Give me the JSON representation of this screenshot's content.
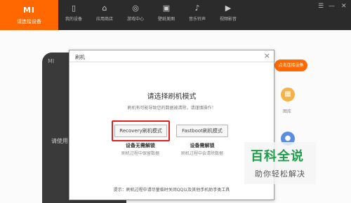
{
  "topbar": {
    "brand": {
      "logo": "MI",
      "label": "请连接设备"
    },
    "nav": [
      {
        "icon": "phone-icon",
        "glyph": "▯",
        "label": "我的设备"
      },
      {
        "icon": "store-icon",
        "glyph": "⌂",
        "label": "应用商店"
      },
      {
        "icon": "gamepad-icon",
        "glyph": "◎",
        "label": "游戏中心"
      },
      {
        "icon": "image-icon",
        "glyph": "▣",
        "label": "壁纸美图"
      },
      {
        "icon": "music-icon",
        "glyph": "♪",
        "label": "音乐铃声"
      },
      {
        "icon": "video-icon",
        "glyph": "▶",
        "label": "视频影音"
      }
    ],
    "window_controls": {
      "menu": "☰",
      "minimize": "—",
      "close": "✕"
    }
  },
  "background": {
    "phone_status": "MI",
    "phone_text": "请使用",
    "orange_pill": "点击连接设备",
    "gallery_label": "图库"
  },
  "dialog": {
    "title": "刷机",
    "close": "×",
    "heading": "请选择刷机模式",
    "subheading": "刷机有可能导致您的数据被清除，请谨慎操作！",
    "recovery": {
      "button": "Recovery刷机模式",
      "title": "设备无需解锁",
      "desc": "刷机过程中保留数据"
    },
    "fastboot": {
      "button": "Fastboot刷机模式",
      "title": "设备需解锁",
      "desc": "刷机过程中会清除数据"
    },
    "tip": "提示：刷机过程中请尽量临时关闭QQ以及其他手机助手类工具"
  },
  "watermark": {
    "big": "百科全说",
    "small": "助你轻松解决"
  },
  "colors": {
    "brand": "#ff6700",
    "topbar": "#2b2b2b",
    "highlight": "#e02020",
    "watermark_green": "#1f9e4a"
  }
}
